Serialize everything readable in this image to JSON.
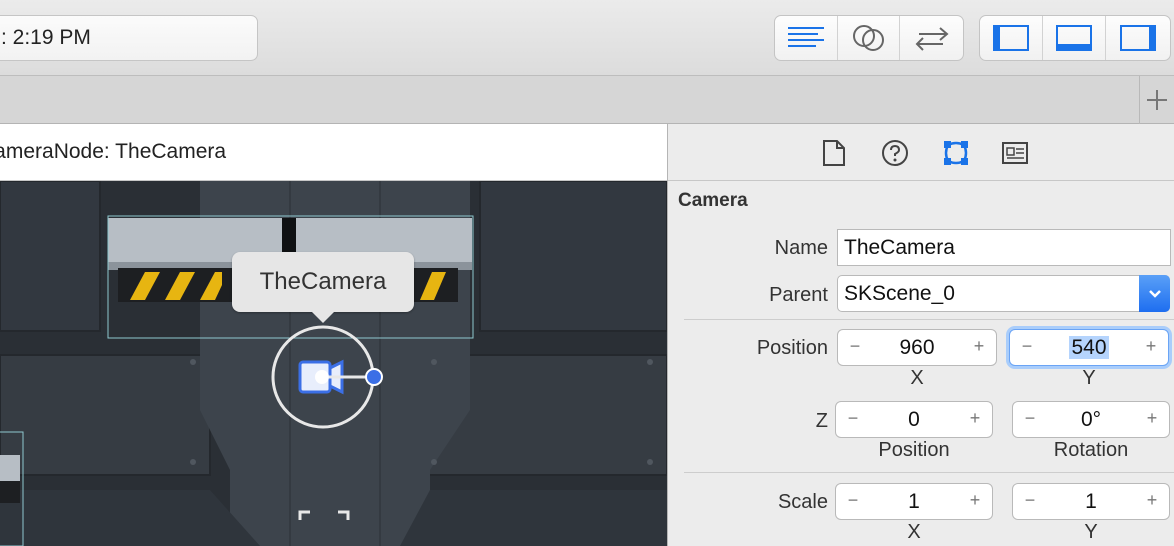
{
  "toolbar": {
    "activity_text": ": 2:19 PM",
    "editor_buttons": [
      "standard-editor",
      "assistant-editor",
      "version-editor"
    ],
    "view_buttons": [
      "navigator-toggle",
      "debug-area-toggle",
      "utilities-toggle"
    ]
  },
  "jumpbar": {
    "path_text": "CameraNode: TheCamera"
  },
  "canvas": {
    "camera_label": "TheCamera"
  },
  "inspector": {
    "tabs": [
      "file-inspector",
      "quick-help",
      "attributes-inspector",
      "identity-inspector"
    ],
    "section_title": "Camera",
    "name_label": "Name",
    "name_value": "TheCamera",
    "parent_label": "Parent",
    "parent_value": "SKScene_0",
    "position_label": "Position",
    "position_x": "960",
    "position_y": "540",
    "x_label": "X",
    "y_label": "Y",
    "z_label": "Z",
    "z_position": "0",
    "z_rotation": "0°",
    "z_position_label": "Position",
    "z_rotation_label": "Rotation",
    "scale_label": "Scale",
    "scale_x": "1",
    "scale_y": "1",
    "minus": "−",
    "plus": "+"
  },
  "colors": {
    "accent": "#1a73e8",
    "canvas_bg": "#2d3238"
  }
}
